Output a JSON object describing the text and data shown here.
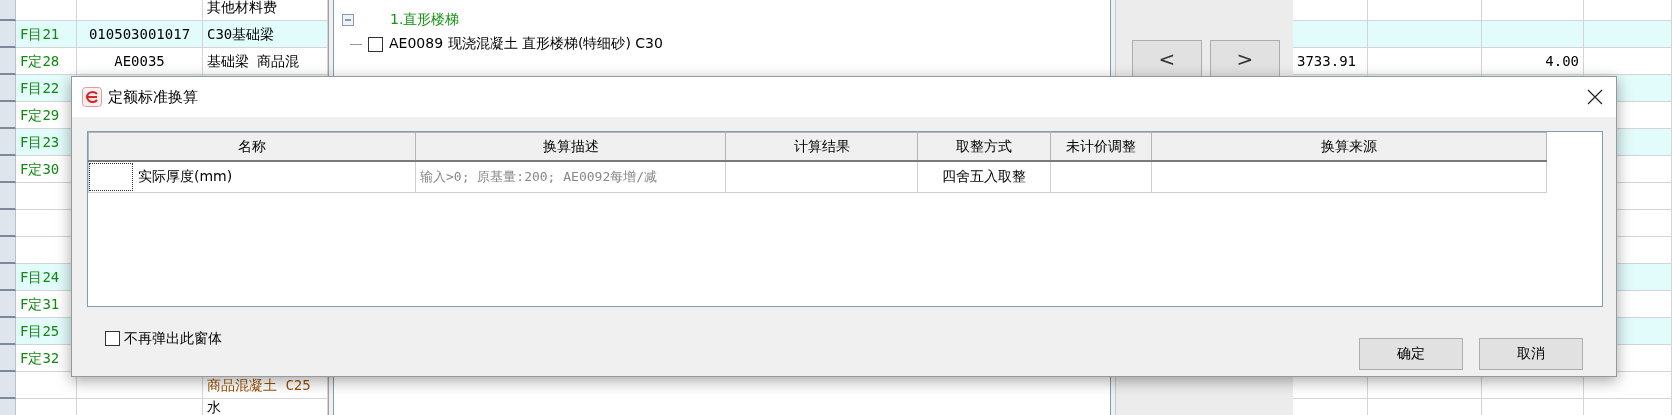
{
  "sheet": {
    "rows": [
      {
        "kind": "material",
        "name": "其他材料费"
      },
      {
        "kind": "section",
        "code": "F目21",
        "number": "010503001017",
        "name": "C30基础梁"
      },
      {
        "kind": "quota",
        "code": "F定28",
        "number": "AE0035",
        "name": "基础梁 商品混",
        "column_6": "3733.91",
        "column_8": "4.00"
      },
      {
        "kind": "section",
        "code": "F目22"
      },
      {
        "kind": "quota",
        "code": "F定29"
      },
      {
        "kind": "section",
        "code": "F目23"
      },
      {
        "kind": "quota",
        "code": "F定30"
      },
      {
        "kind": "blank"
      },
      {
        "kind": "blank"
      },
      {
        "kind": "blank"
      },
      {
        "kind": "section",
        "code": "F目24"
      },
      {
        "kind": "quota",
        "code": "F定31"
      },
      {
        "kind": "section",
        "code": "F目25"
      },
      {
        "kind": "quota",
        "code": "F定32"
      },
      {
        "kind": "mix",
        "name": "商品混凝土 C25"
      },
      {
        "kind": "material",
        "name": "水"
      }
    ]
  },
  "tree_panel": {
    "groups": [
      {
        "label": "1.直形楼梯",
        "expanded": true,
        "children": [
          {
            "label": "AE0089 现浇混凝土 直形楼梯(特细砂) C30",
            "checked": false
          }
        ]
      }
    ],
    "nav_buttons": [
      "<",
      ">"
    ]
  },
  "dialog": {
    "title": "定额标准换算",
    "columns": [
      "名称",
      "换算描述",
      "计算结果",
      "取整方式",
      "未计价调整",
      "换算来源"
    ],
    "rows": [
      {
        "name": "实际厚度(mm)",
        "description": "输入>0; 原基量:200; AE0092每增/减",
        "rounding": "四舍五入取整"
      }
    ],
    "dont_show_again": {
      "label": "不再弹出此窗体",
      "checked": false
    },
    "buttons": [
      "确定",
      "取消"
    ]
  }
}
